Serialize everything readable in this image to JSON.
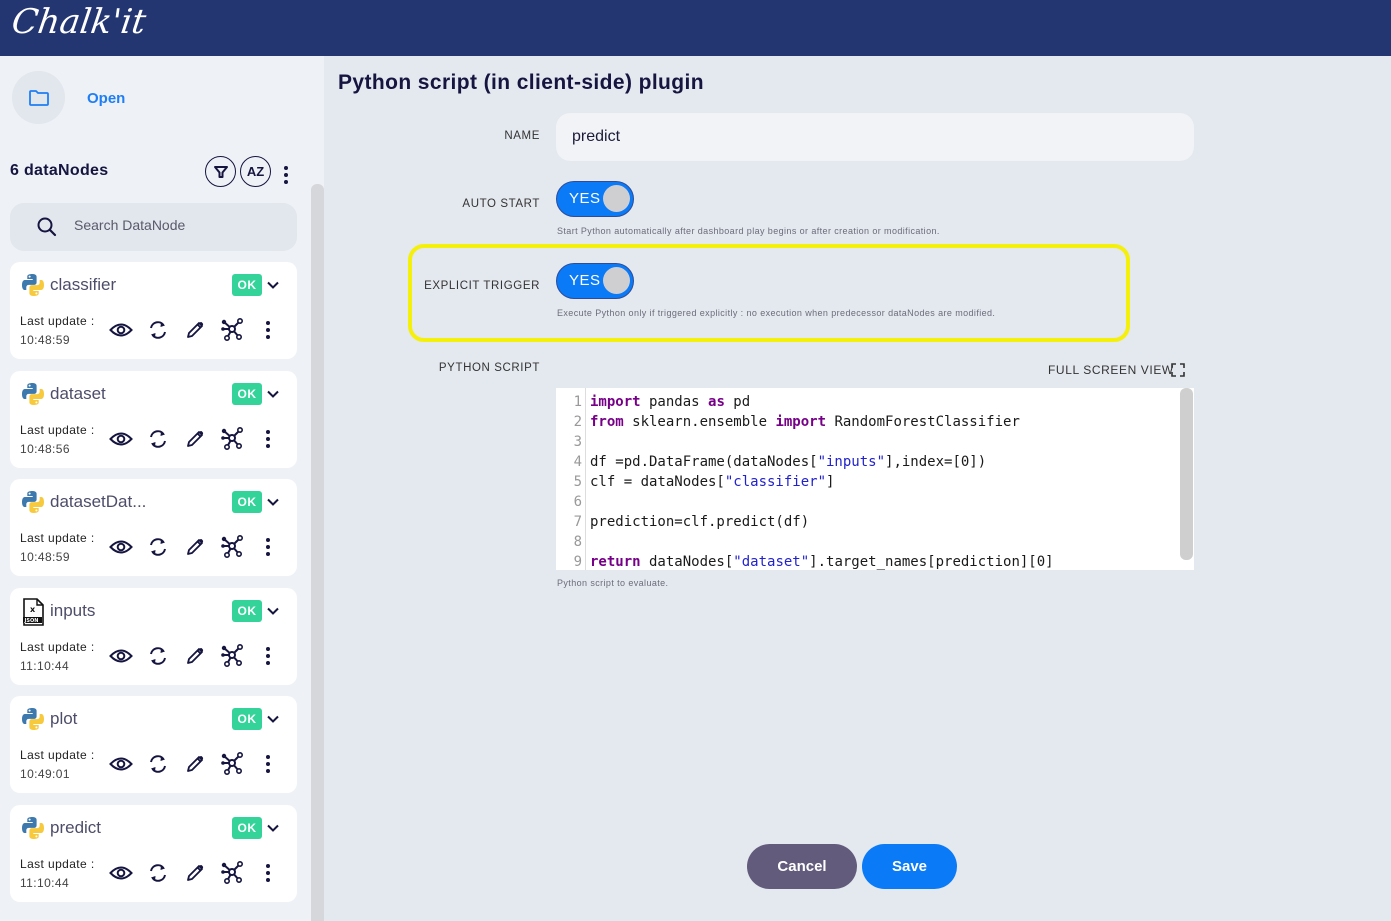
{
  "app": {
    "logo_text": "Chalk'it"
  },
  "sidebar": {
    "open_label": "Open",
    "count_title": "6 dataNodes",
    "sort_label": "AZ",
    "search_placeholder": "Search DataNode",
    "search_value": "",
    "nodes": [
      {
        "name": "classifier",
        "type": "python",
        "status": "OK",
        "last_update_label": "Last update :",
        "last_update": "10:48:59"
      },
      {
        "name": "dataset",
        "type": "python",
        "status": "OK",
        "last_update_label": "Last update :",
        "last_update": "10:48:56"
      },
      {
        "name": "datasetDat...",
        "type": "python",
        "status": "OK",
        "last_update_label": "Last update :",
        "last_update": "10:48:59"
      },
      {
        "name": "inputs",
        "type": "json",
        "status": "OK",
        "last_update_label": "Last update :",
        "last_update": "11:10:44"
      },
      {
        "name": "plot",
        "type": "python",
        "status": "OK",
        "last_update_label": "Last update :",
        "last_update": "10:49:01"
      },
      {
        "name": "predict",
        "type": "python",
        "status": "OK",
        "last_update_label": "Last update :",
        "last_update": "11:10:44"
      }
    ]
  },
  "form": {
    "title": "Python script (in client-side) plugin",
    "name_label": "NAME",
    "name_value": "predict",
    "auto_start_label": "AUTO START",
    "auto_start_value": "YES",
    "auto_start_hint": "Start Python automatically after dashboard play begins or after creation or modification.",
    "explicit_trigger_label": "EXPLICIT TRIGGER",
    "explicit_trigger_value": "YES",
    "explicit_trigger_hint": "Execute Python only if triggered explicitly : no execution when predecessor dataNodes are modified.",
    "script_label": "PYTHON SCRIPT",
    "full_screen_label": "FULL SCREEN VIEW",
    "script_hint": "Python script to evaluate.",
    "code_lines": [
      "import pandas as pd",
      "from sklearn.ensemble import RandomForestClassifier",
      "",
      "df =pd.DataFrame(dataNodes[\"inputs\"],index=[0])",
      "clf = dataNodes[\"classifier\"]",
      "",
      "prediction=clf.predict(df)",
      "",
      "return dataNodes[\"dataset\"].target_names[prediction][0]"
    ],
    "cancel_label": "Cancel",
    "save_label": "Save"
  },
  "colors": {
    "header": "#243672",
    "accent": "#0a7af7",
    "ok_badge": "#34d39a",
    "highlight": "#f5ef0c",
    "cancel": "#625b7c"
  }
}
